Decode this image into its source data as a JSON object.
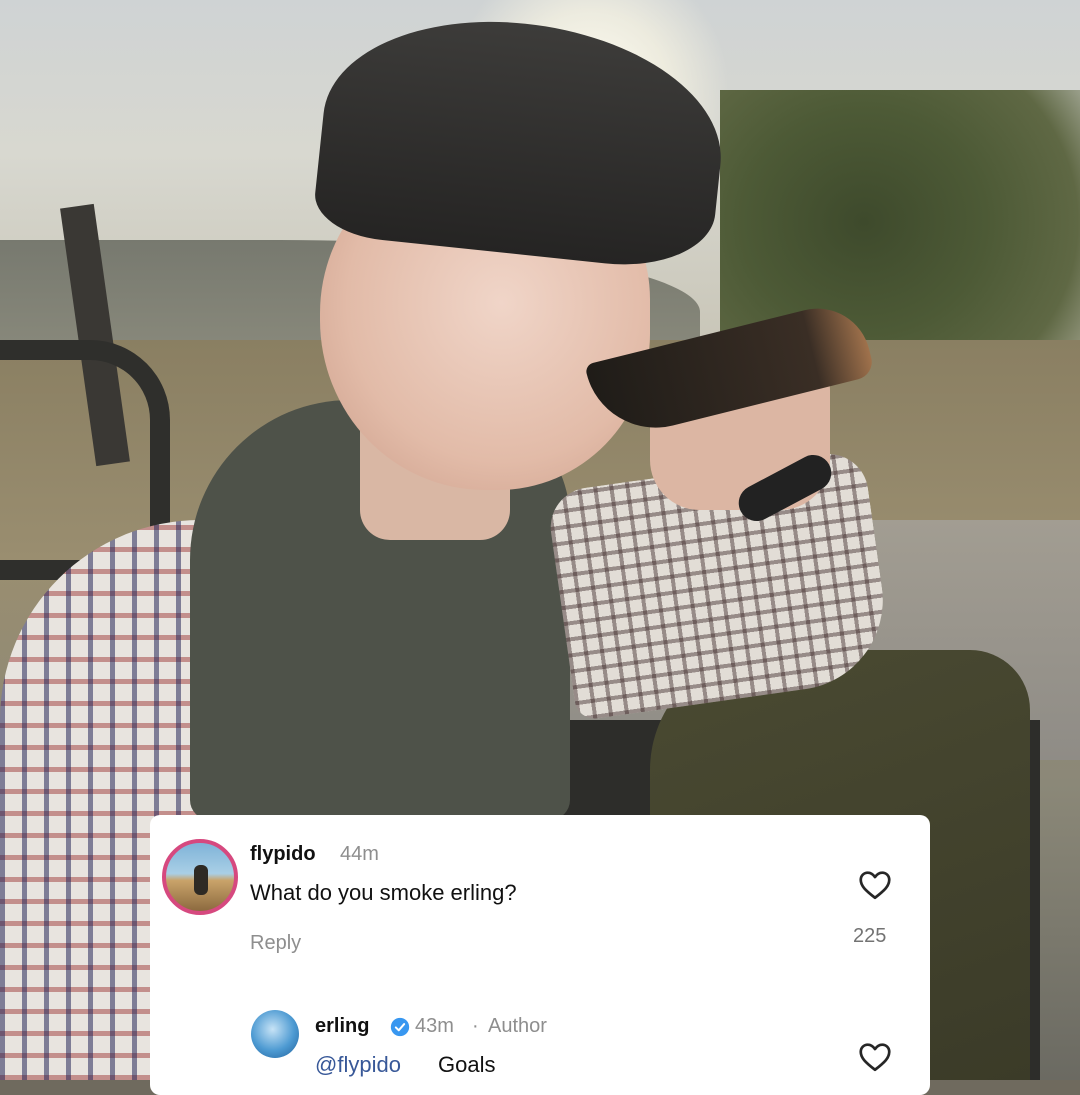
{
  "colors": {
    "card_bg": "#ffffff",
    "username": "#111111",
    "meta_gray": "#8e8e8e",
    "mention_blue": "#385898",
    "verified_blue": "#3897f0",
    "avatar_ring": "#d6497f"
  },
  "comments": [
    {
      "username": "flypido",
      "time": "44m",
      "text": "What do you smoke erling?",
      "reply_label": "Reply",
      "likes": "225",
      "avatar_icon": "profile-photo",
      "like_icon": "heart-outline-icon"
    },
    {
      "username": "erling",
      "verified": true,
      "time": "43m",
      "separator": "·",
      "role": "Author",
      "mention": "@flypido",
      "text": "Goals",
      "avatar_icon": "profile-photo",
      "like_icon": "heart-outline-icon"
    }
  ]
}
